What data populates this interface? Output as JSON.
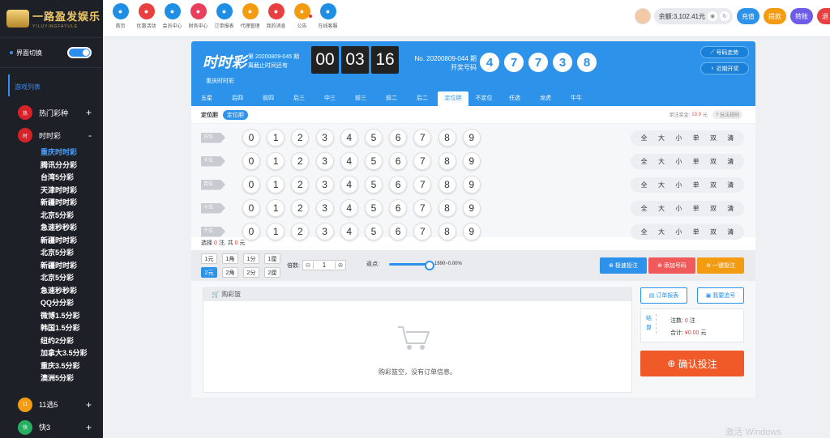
{
  "site": {
    "name": "一路盈发娱乐",
    "sub": "YILUYINGFAYULE"
  },
  "sidebar": {
    "switch_label": "界面切换",
    "list_title": "游戏列表",
    "cat_hot": "热门彩种",
    "cat_ssc": "时时彩",
    "cat_11x5": "11选5",
    "cat_k3": "快3",
    "sub_items": [
      "重庆时时彩",
      "腾讯分分彩",
      "台湾5分彩",
      "天津时时彩",
      "新疆时时彩",
      "北京5分彩",
      "急速秒秒彩",
      "新疆时时彩",
      "北京5分彩",
      "新疆时时彩",
      "北京5分彩",
      "急速秒秒彩",
      "QQ分分彩",
      "微博1.5分彩",
      "韩国1.5分彩",
      "纽约2分彩",
      "加拿大3.5分彩",
      "重庆3.5分彩",
      "澳洲5分彩"
    ]
  },
  "nav": [
    {
      "label": "首页",
      "icon": "home-icon",
      "color": "#1f8fe5"
    },
    {
      "label": "优惠活动",
      "icon": "gift-icon",
      "color": "#e84040"
    },
    {
      "label": "会员中心",
      "icon": "user-icon",
      "color": "#1f8fe5"
    },
    {
      "label": "财务中心",
      "icon": "wallet-icon",
      "color": "#e8405c"
    },
    {
      "label": "订单报表",
      "icon": "report-icon",
      "color": "#1f8fe5"
    },
    {
      "label": "代理管理",
      "icon": "agent-icon",
      "color": "#f39c12"
    },
    {
      "label": "我的消息",
      "icon": "message-icon",
      "color": "#e84040"
    },
    {
      "label": "公告",
      "icon": "notice-icon",
      "color": "#f39c12"
    },
    {
      "label": "在线客服",
      "icon": "service-icon",
      "color": "#1f8fe5"
    }
  ],
  "account": {
    "balance": "余额:3,102.41元",
    "btn_recharge": "充值",
    "btn_withdraw": "提款",
    "btn_transfer": "转账",
    "btn_logout": "退"
  },
  "game": {
    "logo": "时时彩",
    "name": "重庆时时彩",
    "issue_line1": "第 20200809-045 期",
    "issue_line2": "离截止时间还有",
    "timer": [
      "00",
      "03",
      "16"
    ],
    "last_line1": "No. 20200809-044 期",
    "last_line2": "开奖号码",
    "balls": [
      "4",
      "7",
      "7",
      "3",
      "8"
    ],
    "btn_trend": "号码走势",
    "btn_recent": "近期开奖",
    "tabs": [
      "五星",
      "后四",
      "前四",
      "后三",
      "中三",
      "前三",
      "前二",
      "后二",
      "定位胆",
      "不定位",
      "任选",
      "龙虎",
      "牛牛"
    ],
    "play_label": "定位胆",
    "play_pill": "定位胆",
    "bonus_label": "单注奖金:",
    "bonus_amt": "19.9",
    "bonus_unit": "元",
    "rules": "玩法规则"
  },
  "positions": [
    "万位",
    "千位",
    "百位",
    "十位",
    "个位"
  ],
  "digits": [
    "0",
    "1",
    "2",
    "3",
    "4",
    "5",
    "6",
    "7",
    "8",
    "9"
  ],
  "quick": [
    "全",
    "大",
    "小",
    "单",
    "双",
    "清"
  ],
  "selection": {
    "pre": "选择",
    "count": "0",
    "mid": "注, 共",
    "amount": "0",
    "post": "元"
  },
  "units": [
    "1元",
    "1角",
    "1分",
    "1厘",
    "2元",
    "2角",
    "2分",
    "2厘"
  ],
  "multiplier": {
    "label": "倍数:",
    "value": "1"
  },
  "rebate": {
    "label": "返点:",
    "value": "1990~0.00%"
  },
  "actions": {
    "quick_bet": "极速投注",
    "add_number": "添加号码",
    "one_key": "一键投注"
  },
  "cart": {
    "title": "购彩篮",
    "empty": "购彩篮空，没有订单信息。"
  },
  "right": {
    "order_report": "订单报表",
    "my_chase": "我要追号",
    "settle_side": "结算",
    "bets_label": "注数:",
    "bets_val": "0",
    "bets_unit": "注",
    "total_label": "合计:",
    "total_val": "¥0.00",
    "total_unit": "元",
    "confirm": "确认投注"
  },
  "watermark": "激活 Windows"
}
